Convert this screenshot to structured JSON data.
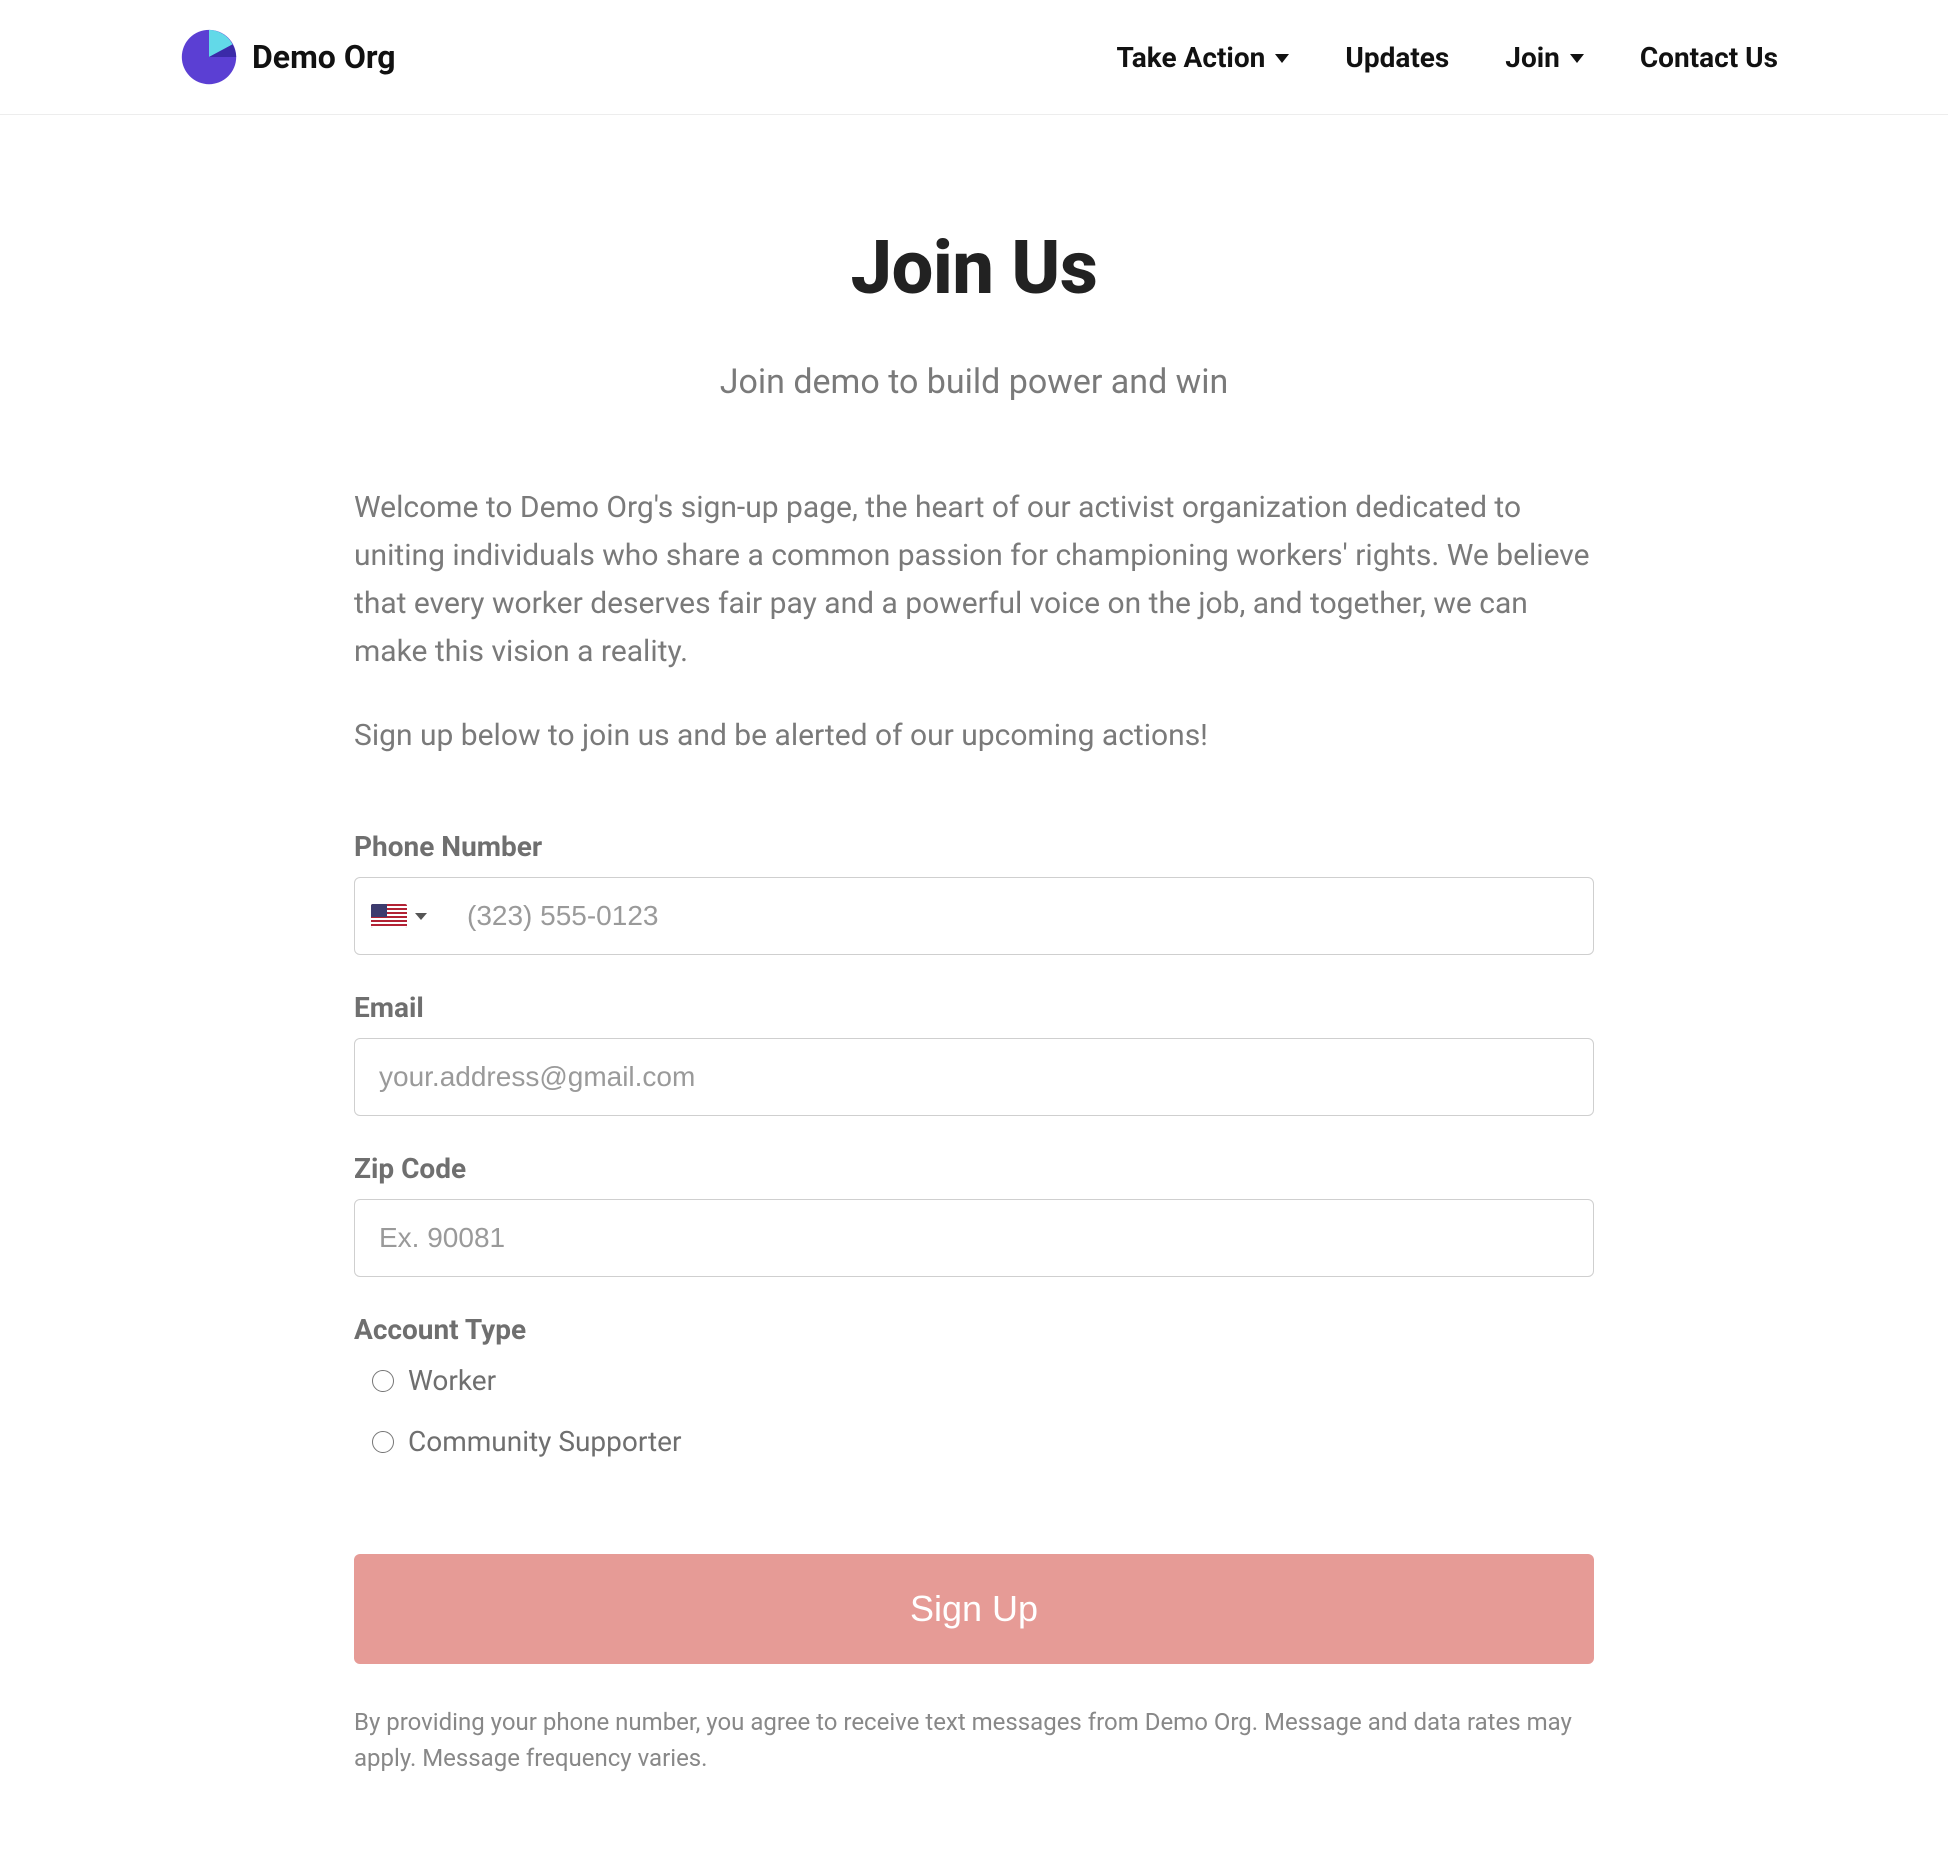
{
  "brand": {
    "name": "Demo Org"
  },
  "nav": [
    {
      "label": "Take Action",
      "dropdown": true
    },
    {
      "label": "Updates",
      "dropdown": false
    },
    {
      "label": "Join",
      "dropdown": true
    },
    {
      "label": "Contact Us",
      "dropdown": false
    }
  ],
  "hero": {
    "title": "Join Us",
    "subtitle": "Join demo to build power and win"
  },
  "intro": {
    "p1": "Welcome to Demo Org's sign-up page, the heart of our activist organization dedicated to uniting individuals who share a common passion for championing workers' rights. We believe that every worker deserves fair pay and a powerful voice on the job, and together, we can make this vision a reality.",
    "p2": "Sign up below to join us and be alerted of our upcoming actions!"
  },
  "form": {
    "phone": {
      "label": "Phone Number",
      "placeholder": "(323) 555-0123",
      "country": "us"
    },
    "email": {
      "label": "Email",
      "placeholder": "your.address@gmail.com"
    },
    "zip": {
      "label": "Zip Code",
      "placeholder": "Ex. 90081"
    },
    "account_type": {
      "label": "Account Type",
      "options": [
        "Worker",
        "Community Supporter"
      ]
    },
    "submit_label": "Sign Up"
  },
  "disclaimer": "By providing your phone number, you agree to receive text messages from Demo Org. Message and data rates may apply. Message frequency varies."
}
